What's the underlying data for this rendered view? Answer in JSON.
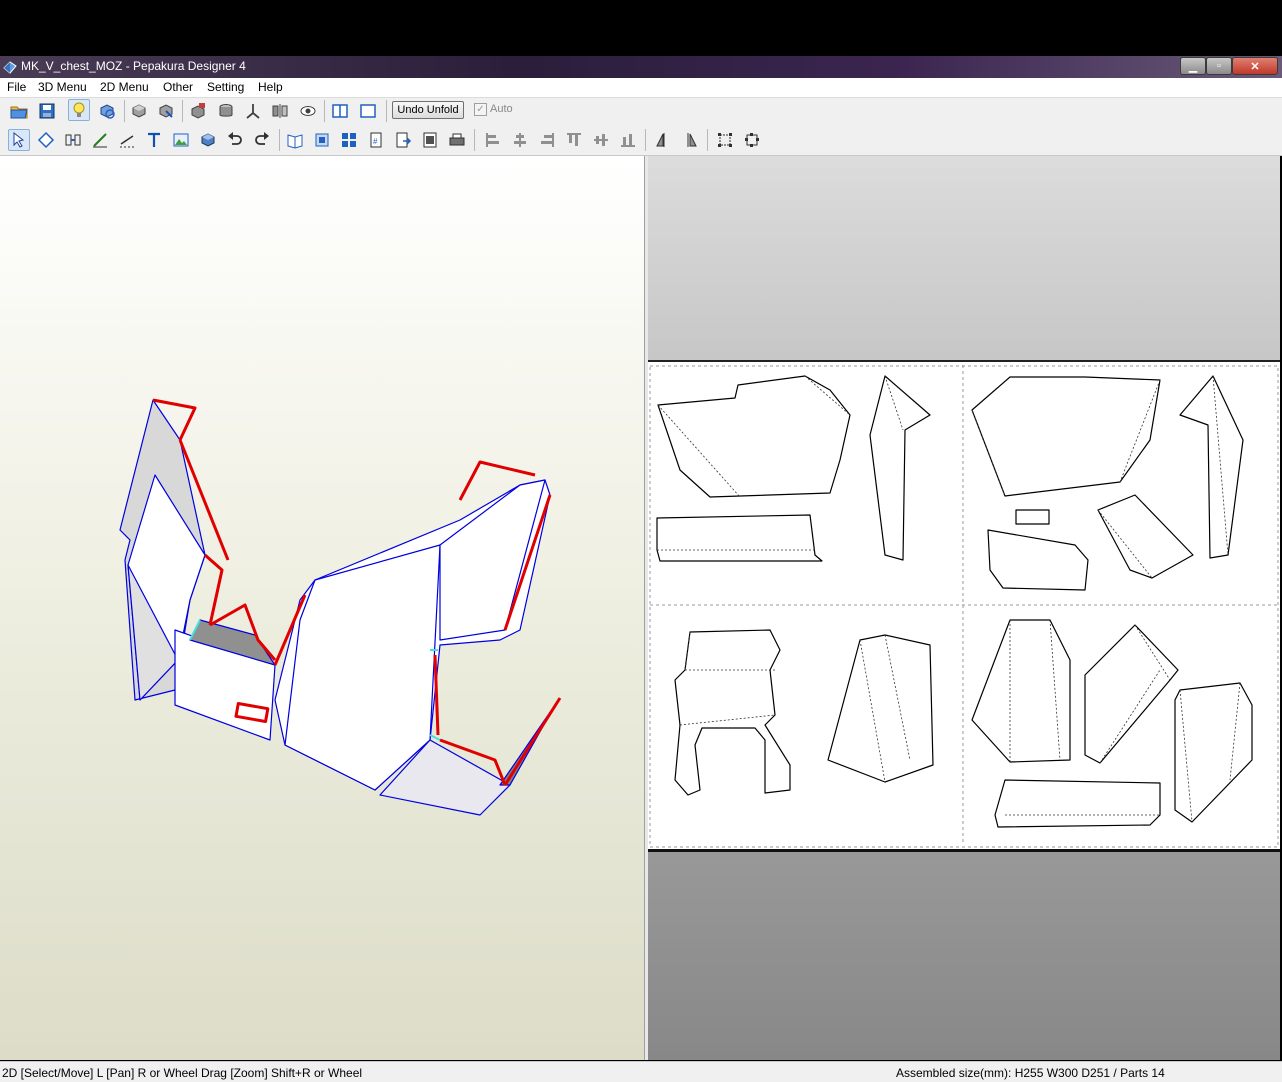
{
  "window": {
    "title": "MK_V_chest_MOZ - Pepakura Designer 4",
    "controls": {
      "minimize": "▁",
      "maximize": "▫",
      "close": "✕"
    }
  },
  "menubar": {
    "items": [
      "File",
      "3D Menu",
      "2D Menu",
      "Other",
      "Setting",
      "Help"
    ]
  },
  "toolbar": {
    "undo_unfold_label": "Undo Unfold",
    "auto_label": "Auto",
    "auto_checked": true,
    "row1_icons": [
      "open-icon",
      "save-icon",
      "lightbulb-icon",
      "3d-rotate-icon",
      "edge-join-icon",
      "edge-split-icon",
      "texture-icon",
      "cylinder-icon",
      "axis-icon",
      "mirror-icon",
      "show-flaps-icon",
      "split-view-icon",
      "single-view-icon"
    ],
    "row2_icons": [
      "select-move-icon",
      "rotate-part-icon",
      "join-edge-icon",
      "draw-line-icon",
      "fold-line-icon",
      "text-icon",
      "image-icon",
      "3d-box-icon",
      "undo-icon",
      "redo-icon",
      "unfold-book-icon",
      "arrange-parts-icon",
      "layout-grid-icon",
      "page-number-icon",
      "export-icon",
      "print-preview-icon",
      "print-icon",
      "align-left-icon",
      "align-center-icon",
      "align-right-icon",
      "align-top-icon",
      "align-middle-icon",
      "align-bottom-icon",
      "flip-horizontal-icon",
      "flip-vertical-icon",
      "fit-box-icon",
      "snap-icon"
    ]
  },
  "status": {
    "left": "2D [Select/Move] L [Pan] R or Wheel Drag [Zoom] Shift+R or Wheel",
    "right": "Assembled size(mm): H255 W300 D251 / Parts 14"
  },
  "colors": {
    "model_edge_blue": "#0000e0",
    "flap_edge_red": "#e00000",
    "seam_cyan": "#40e0e0",
    "model_gray": "#a8a8a8"
  }
}
